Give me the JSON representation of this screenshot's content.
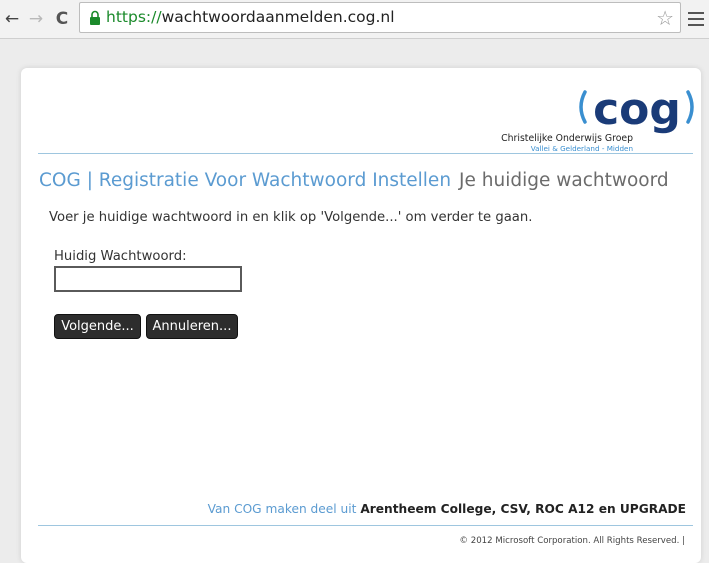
{
  "browser": {
    "url_scheme": "https://",
    "url_host": "wachtwoordaanmelden.cog.nl",
    "back_glyph": "←",
    "forward_glyph": "→",
    "reload_glyph": "C",
    "star_glyph": "☆"
  },
  "logo": {
    "wordmark": "cog",
    "org_name": "Christelijke Onderwijs Groep",
    "region": "Vallei & Gelderland - Midden",
    "brand_color": "#1a3b78",
    "accent_color": "#3a8fd0"
  },
  "header": {
    "app_title": "COG | Registratie Voor Wachtwoord Instellen",
    "page_title": "Je huidige wachtwoord"
  },
  "form": {
    "instruction": "Voer je huidige wachtwoord in en klik op 'Volgende...' om verder te gaan.",
    "current_password_label": "Huidig Wachtwoord:",
    "current_password_value": "",
    "next_label": "Volgende...",
    "cancel_label": "Annuleren..."
  },
  "footer": {
    "prefix": "Van COG maken deel uit",
    "orgs": "Arentheem College, CSV, ROC A12 en UPGRADE",
    "copyright": "© 2012 Microsoft Corporation. All Rights Reserved. |"
  },
  "colors": {
    "link_blue": "#5b9bd1",
    "secure_green": "#1b8a2b",
    "button_dark": "#2d2d2d"
  }
}
